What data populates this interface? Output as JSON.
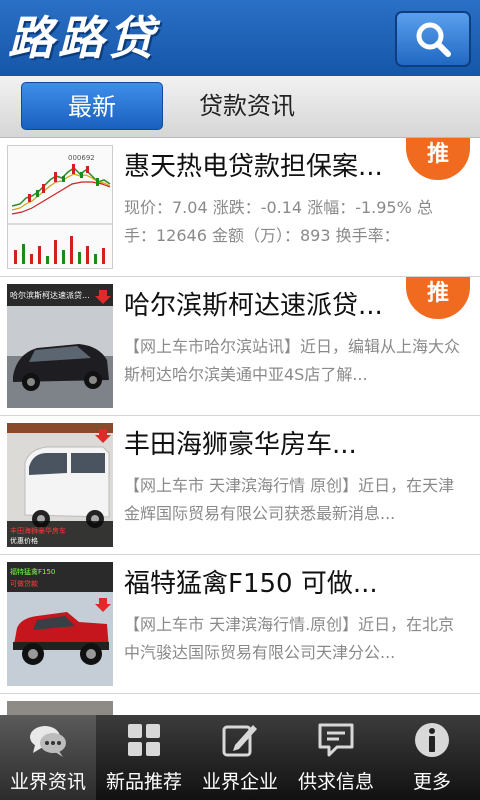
{
  "header": {
    "logo_text": "路路贷",
    "search_icon": "search-icon"
  },
  "tabs": [
    {
      "label": "最新",
      "active": true
    },
    {
      "label": "贷款资讯",
      "active": false
    }
  ],
  "items": [
    {
      "title": "惠天热电贷款担保案...",
      "summary": "现价：7.04 涨跌：-0.14 涨幅：-1.95% 总手：12646 金额（万）：893 换手率：",
      "badge": "推",
      "thumb": "stock-chart"
    },
    {
      "title": "哈尔滨斯柯达速派贷...",
      "summary": "【网上车市哈尔滨站讯】近日，编辑从上海大众斯柯达哈尔滨美通中亚4S店了解...",
      "badge": "推",
      "thumb": "car-photo"
    },
    {
      "title": "丰田海狮豪华房车...",
      "summary": "【网上车市 天津滨海行情 原创】近日，在天津金辉国际贸易有限公司获悉最新消息...",
      "badge": "",
      "thumb": "van-photo"
    },
    {
      "title": "福特猛禽F150 可做...",
      "summary": "【网上车市 天津滨海行情.原创】近日，在北京中汽骏达国际贸易有限公司天津分公...",
      "badge": "",
      "thumb": "truck-photo"
    }
  ],
  "bottom_nav": [
    {
      "label": "业界资讯",
      "icon": "chat-bubbles-icon",
      "active": true
    },
    {
      "label": "新品推荐",
      "icon": "grid-icon",
      "active": false
    },
    {
      "label": "业界企业",
      "icon": "edit-icon",
      "active": false
    },
    {
      "label": "供求信息",
      "icon": "message-icon",
      "active": false
    },
    {
      "label": "更多",
      "icon": "info-icon",
      "active": false
    }
  ],
  "colors": {
    "header": "#1e63b8",
    "badge": "#f06a1f",
    "nav_bg": "#1f1f1f"
  }
}
